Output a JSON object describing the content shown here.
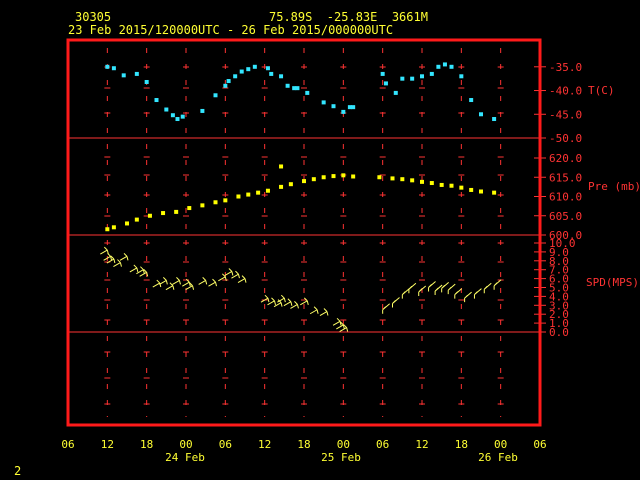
{
  "header": {
    "station_id": "30305",
    "location": "75.89S  -25.83E  3661M",
    "time_range": "23 Feb 2015/120000UTC - 26 Feb 2015/000000UTC"
  },
  "page_number": "2",
  "colors": {
    "frame": "#ff1a1a",
    "grid": "#ff3333",
    "labels": "#ffff33",
    "temperature": "#33e6ff",
    "pressure": "#ffff00",
    "wind": "#ffff66"
  },
  "chart_data": {
    "type": "scatter",
    "x_tick_labels": [
      "06",
      "12",
      "18",
      "00",
      "06",
      "12",
      "18",
      "00",
      "06",
      "12",
      "18",
      "00",
      "06"
    ],
    "date_labels": [
      "24 Feb",
      "25 Feb",
      "26 Feb"
    ],
    "panels": [
      {
        "label": "T(C)",
        "ticks": [
          "-35.0",
          "-40.0",
          "-45.0",
          "-50.0"
        ],
        "ylim": [
          -52,
          -32
        ],
        "series": [
          {
            "name": "T(C)",
            "points": [
              [
                12,
                -35.0
              ],
              [
                13,
                -35.3
              ],
              [
                14.5,
                -36.8
              ],
              [
                16.5,
                -36.5
              ],
              [
                18,
                -38.2
              ],
              [
                19.5,
                -42
              ],
              [
                21,
                -44
              ],
              [
                22,
                -45.2
              ],
              [
                22.7,
                -46
              ],
              [
                23.5,
                -45.5
              ],
              [
                26.5,
                -44.3
              ],
              [
                28.5,
                -41
              ],
              [
                30,
                -39
              ],
              [
                30.5,
                -38
              ],
              [
                31.5,
                -37
              ],
              [
                32.5,
                -36
              ],
              [
                33.5,
                -35.5
              ],
              [
                34.5,
                -35
              ],
              [
                36.5,
                -35.3
              ],
              [
                37,
                -36.5
              ],
              [
                38.5,
                -37
              ],
              [
                39.5,
                -39
              ],
              [
                40.5,
                -39.5
              ],
              [
                41,
                -39.5
              ],
              [
                42.5,
                -40.5
              ],
              [
                45,
                -42.5
              ],
              [
                46.5,
                -43.3
              ],
              [
                48,
                -44.5
              ],
              [
                49,
                -43.5
              ],
              [
                49.5,
                -43.5
              ],
              [
                54,
                -36.5
              ],
              [
                54.5,
                -38.5
              ],
              [
                56,
                -40.5
              ],
              [
                57,
                -37.5
              ],
              [
                58.5,
                -37.5
              ],
              [
                60,
                -37
              ],
              [
                61.5,
                -36.5
              ],
              [
                62.5,
                -35
              ],
              [
                63.5,
                -34.5
              ],
              [
                64.5,
                -35
              ],
              [
                66,
                -37
              ],
              [
                67.5,
                -42
              ],
              [
                69,
                -45
              ],
              [
                71,
                -46
              ]
            ]
          }
        ]
      },
      {
        "label": "Pre (mb)",
        "ticks": [
          "620.0",
          "615.0",
          "610.0",
          "605.0",
          "600.0"
        ],
        "ylim": [
          598.5,
          623.5
        ],
        "series": [
          {
            "name": "Pre (mb)",
            "points": [
              [
                12,
                601.5
              ],
              [
                13,
                602
              ],
              [
                15,
                603
              ],
              [
                16.5,
                604
              ],
              [
                18.5,
                605
              ],
              [
                20.5,
                605.7
              ],
              [
                22.5,
                606
              ],
              [
                24.5,
                607
              ],
              [
                26.5,
                607.7
              ],
              [
                28.5,
                608.5
              ],
              [
                30,
                609
              ],
              [
                32,
                610
              ],
              [
                33.5,
                610.5
              ],
              [
                35,
                611
              ],
              [
                36.5,
                611.5
              ],
              [
                38.5,
                612.5
              ],
              [
                40,
                613.2
              ],
              [
                42,
                614
              ],
              [
                43.5,
                614.5
              ],
              [
                45,
                615
              ],
              [
                46.5,
                615.3
              ],
              [
                48,
                615.5
              ],
              [
                49.5,
                615.2
              ],
              [
                53.5,
                615
              ],
              [
                55.5,
                614.7
              ],
              [
                57,
                614.5
              ],
              [
                58.5,
                614.2
              ],
              [
                60,
                613.8
              ],
              [
                61.5,
                613.5
              ],
              [
                63,
                613
              ],
              [
                64.5,
                612.8
              ],
              [
                66,
                612.3
              ],
              [
                67.5,
                611.7
              ],
              [
                69,
                611.3
              ],
              [
                71,
                611
              ],
              [
                38.5,
                617.8
              ]
            ]
          }
        ]
      },
      {
        "label": "SPD(MPS)",
        "ticks": [
          "10.0",
          "9.0",
          "8.0",
          "7.0",
          "6.0",
          "5.0",
          "4.0",
          "3.0",
          "2.0",
          "1.0",
          "0.0"
        ],
        "ylim": [
          0,
          10
        ],
        "series": [
          {
            "name": "SPD(MPS)",
            "points": [
              [
                12,
                9.2
              ],
              [
                12.5,
                8.5
              ],
              [
                13,
                8.2
              ],
              [
                14,
                7.8
              ],
              [
                15,
                8.5
              ],
              [
                16.5,
                7.2
              ],
              [
                17.5,
                7
              ],
              [
                18,
                6.7
              ],
              [
                20,
                5.5
              ],
              [
                21,
                5.8
              ],
              [
                22,
                5.2
              ],
              [
                23,
                5.8
              ],
              [
                24.5,
                5.6
              ],
              [
                25,
                5.2
              ],
              [
                27,
                5.8
              ],
              [
                28.5,
                5.6
              ],
              [
                30,
                6.2
              ],
              [
                31,
                6.8
              ],
              [
                32,
                6.5
              ],
              [
                33,
                6
              ],
              [
                36.5,
                3.8
              ],
              [
                37.5,
                3.5
              ],
              [
                38.5,
                3.3
              ],
              [
                39,
                3.8
              ],
              [
                40,
                3.4
              ],
              [
                41,
                3.1
              ],
              [
                42.5,
                3.5
              ],
              [
                44,
                2.5
              ],
              [
                45.5,
                2.3
              ],
              [
                47.5,
                1.2
              ],
              [
                48,
                0.8
              ],
              [
                48.5,
                0.5
              ],
              [
                54,
                2.5
              ],
              [
                55.5,
                3.2
              ],
              [
                57,
                4.2
              ],
              [
                58,
                4.8
              ],
              [
                59.5,
                4.5
              ],
              [
                61,
                5
              ],
              [
                62,
                4.6
              ],
              [
                63,
                4.9
              ],
              [
                64,
                4.7
              ],
              [
                65,
                4.2
              ],
              [
                66.5,
                3.8
              ],
              [
                68,
                4.2
              ],
              [
                69.5,
                4.8
              ],
              [
                71,
                5.2
              ]
            ]
          }
        ]
      }
    ]
  }
}
